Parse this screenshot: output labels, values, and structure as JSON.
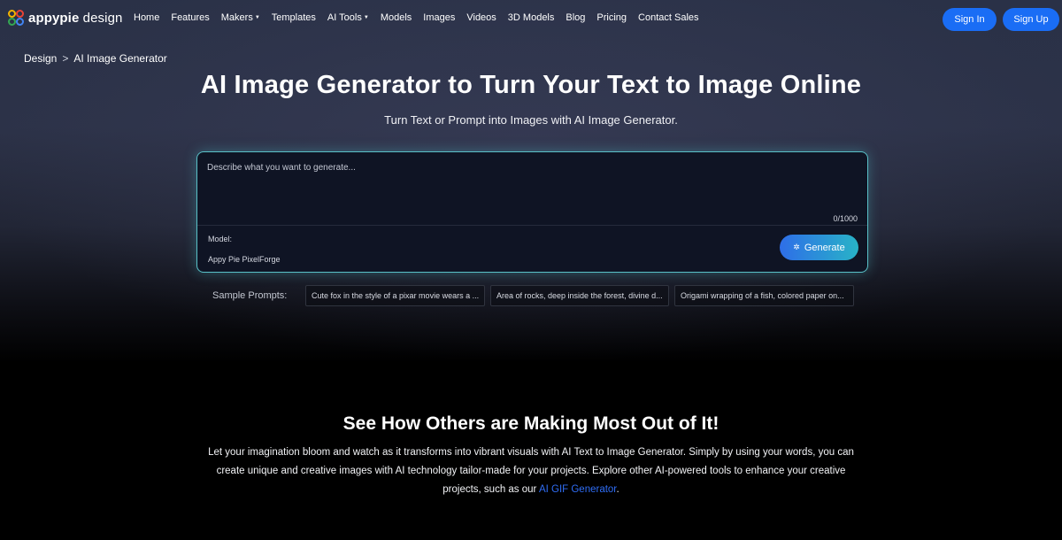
{
  "header": {
    "logo_bold": "appypie",
    "logo_light": " design",
    "nav": [
      {
        "label": "Home",
        "dropdown": false
      },
      {
        "label": "Features",
        "dropdown": false
      },
      {
        "label": "Makers",
        "dropdown": true
      },
      {
        "label": "Templates",
        "dropdown": false
      },
      {
        "label": "AI Tools",
        "dropdown": true
      },
      {
        "label": "Models",
        "dropdown": false
      },
      {
        "label": "Images",
        "dropdown": false
      },
      {
        "label": "Videos",
        "dropdown": false
      },
      {
        "label": "3D Models",
        "dropdown": false
      },
      {
        "label": "Blog",
        "dropdown": false
      },
      {
        "label": "Pricing",
        "dropdown": false
      },
      {
        "label": "Contact Sales",
        "dropdown": false
      }
    ],
    "sign_in": "Sign In",
    "sign_up": "Sign Up"
  },
  "breadcrumb": {
    "root": "Design",
    "separator": ">",
    "current": "AI Image Generator"
  },
  "hero": {
    "title": "AI Image Generator to Turn Your Text to Image Online",
    "subtitle": "Turn Text or Prompt into Images with AI Image Generator."
  },
  "prompt": {
    "placeholder": "Describe what you want to generate...",
    "value": "",
    "counter": "0/1000",
    "model_label": "Model:",
    "model_value": "Appy Pie PixelForge",
    "generate_label": "Generate"
  },
  "samples": {
    "label": "Sample Prompts:",
    "items": [
      "Cute fox in the style of a pixar movie wears a ...",
      "Area of rocks, deep inside the forest, divine d...",
      "Origami wrapping of a fish, colored paper on..."
    ]
  },
  "showcase": {
    "title": "See How Others are Making Most Out of It!",
    "text": "Let your imagination bloom and watch as it transforms into vibrant visuals with AI Text to Image Generator. Simply by using your words, you can create unique and creative images with AI technology tailor-made for your projects. Explore other AI-powered tools to enhance your creative projects, such as our ",
    "link": "AI GIF Generator",
    "text_end": "."
  },
  "colors": {
    "accent": "#1a6df5",
    "prompt_border": "#59c1c8",
    "generate_gradient_start": "#2e6ee8",
    "generate_gradient_end": "#28b3c7",
    "link": "#2f6df5"
  }
}
